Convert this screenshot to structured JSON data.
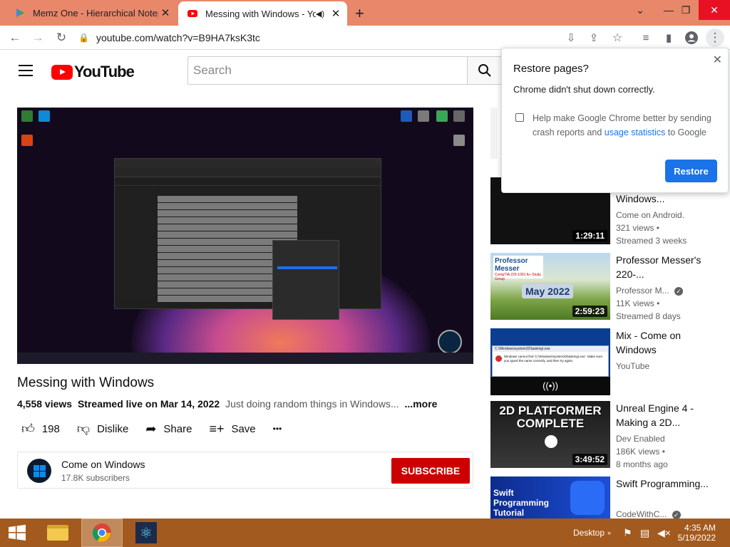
{
  "browser": {
    "tabs": [
      {
        "label": "Memz One - Hierarchical Notepa",
        "close": "✕"
      },
      {
        "label": "Messing with Windows - You",
        "close": "✕"
      }
    ],
    "new_tab": "+",
    "url": "youtube.com/watch?v=B9HA7ksK3tc"
  },
  "youtube": {
    "logo_text": "YouTube",
    "search_placeholder": "Search"
  },
  "video": {
    "title": "Messing with Windows",
    "views": "4,558 views",
    "streamed": "Streamed live on Mar 14, 2022",
    "description": "Just doing random things in Windows...",
    "more": "...more",
    "likes": "198",
    "dislike_label": "Dislike",
    "share_label": "Share",
    "save_label": "Save",
    "more_actions": "•••"
  },
  "channel": {
    "name": "Come on Windows",
    "subscribers": "17.8K subscribers",
    "subscribe_label": "SUBSCRIBE"
  },
  "recommendations": [
    {
      "title": "Windows...",
      "channel": "Come on Android.",
      "views": "321 views •",
      "age": "Streamed 3 weeks",
      "duration": "1:29:11"
    },
    {
      "title": "Professor Messer's 220-...",
      "channel": "Professor M...",
      "views": "11K views •",
      "age": "Streamed 8 days",
      "duration": "2:59:23",
      "thumb_brand": "Professor Messer",
      "thumb_course": "CompTIA 220-1001 A+ Study Group",
      "thumb_date": "May 2022"
    },
    {
      "title": "Mix - Come on Windows",
      "channel": "YouTube",
      "thumb_dialog": "C:\\Windows\\system32\\taskmgr.exe",
      "thumb_error": "Windows cannot find 'C:\\Windows\\system32\\taskmgr.exe'. Make sure you typed the name correctly, and then try again."
    },
    {
      "title": "Unreal Engine 4 - Making a 2D...",
      "channel": "Dev Enabled",
      "views": "186K views •",
      "age": "8 months ago",
      "duration": "3:49:52",
      "thumb_text": "2D PLATFORMER COMPLETE"
    },
    {
      "title": "Swift Programming...",
      "channel": "CodeWithC...",
      "thumb_text": "Swift Programming Tutorial"
    }
  ],
  "restore_popup": {
    "title": "Restore pages?",
    "body": "Chrome didn't shut down correctly.",
    "note_prefix": "Help make Google Chrome better by sending crash reports and",
    "note_link": "usage statistics",
    "note_suffix": "to Google",
    "button": "Restore"
  },
  "taskbar": {
    "desktop_label": "Desktop",
    "time": "4:35 AM",
    "date": "5/19/2022"
  },
  "colors": {
    "tabbar": "#e8876a",
    "taskbar": "#a35a1e",
    "subscribe": "#cc0000",
    "restore_button": "#1a73e8",
    "youtube_red": "#ff0000"
  }
}
